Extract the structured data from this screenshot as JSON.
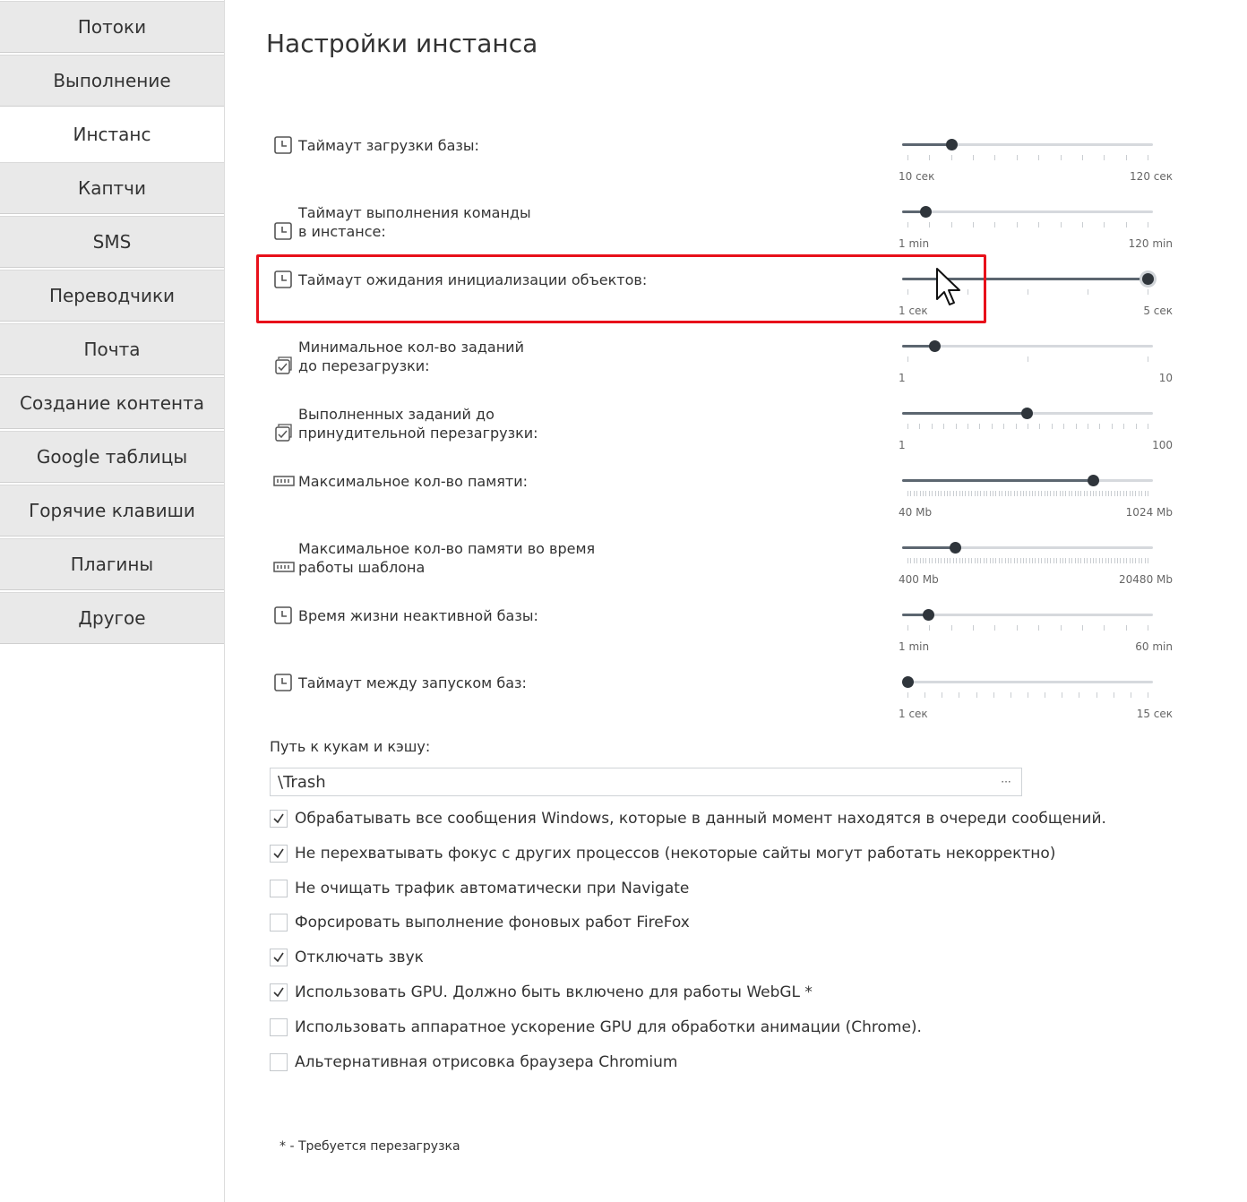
{
  "sidebar": {
    "items": [
      {
        "label": "Потоки",
        "active": false
      },
      {
        "label": "Выполнение",
        "active": false
      },
      {
        "label": "Инстанс",
        "active": true
      },
      {
        "label": "Каптчи",
        "active": false
      },
      {
        "label": "SMS",
        "active": false
      },
      {
        "label": "Переводчики",
        "active": false
      },
      {
        "label": "Почта",
        "active": false
      },
      {
        "label": "Создание контента",
        "active": false
      },
      {
        "label": "Google таблицы",
        "active": false
      },
      {
        "label": "Горячие клавиши",
        "active": false
      },
      {
        "label": "Плагины",
        "active": false
      },
      {
        "label": "Другое",
        "active": false
      }
    ]
  },
  "main": {
    "title": "Настройки инстанса",
    "sliders": [
      {
        "label": "Таймаут загрузки базы:",
        "icon": "clock-icon",
        "min_label": "10 сек",
        "max_label": "120 сек",
        "min": 10,
        "max": 120,
        "value": 30,
        "ticks": 12
      },
      {
        "label": "Таймаут выполнения команды\nв инстансе:",
        "icon": "clock-icon",
        "min_label": "1 min",
        "max_label": "120 min",
        "min": 1,
        "max": 120,
        "value": 10,
        "ticks": 12
      },
      {
        "label": "Таймаут ожидания инициализации объектов:",
        "icon": "clock-icon",
        "min_label": "1 сек",
        "max_label": "5 сек",
        "min": 1,
        "max": 5,
        "value": 5,
        "ticks": 5,
        "hover": true
      },
      {
        "label": "Минимальное кол-во заданий\nдо перезагрузки:",
        "icon": "task-icon",
        "min_label": "1",
        "max_label": "10",
        "min": 1,
        "max": 10,
        "value": 2,
        "ticks": 3
      },
      {
        "label": "Выполненных заданий до\nпринудительной перезагрузки:",
        "icon": "task-icon",
        "min_label": "1",
        "max_label": "100",
        "min": 1,
        "max": 100,
        "value": 50,
        "ticks": 21
      },
      {
        "label": "Максимальное кол-во памяти:",
        "icon": "memory-icon",
        "min_label": "40 Mb",
        "max_label": "1024 Mb",
        "min": 40,
        "max": 1024,
        "value": 800,
        "ticks": 80
      },
      {
        "label": "Максимальное кол-во памяти во время\nработы шаблона",
        "icon": "memory-icon",
        "min_label": "400 Mb",
        "max_label": "20480 Mb",
        "min": 400,
        "max": 20480,
        "value": 4400,
        "ticks": 80
      },
      {
        "label": "Время жизни неактивной базы:",
        "icon": "clock-icon",
        "min_label": "1 min",
        "max_label": "60 min",
        "min": 1,
        "max": 60,
        "value": 6,
        "ticks": 12
      },
      {
        "label": "Таймаут между запуском баз:",
        "icon": "clock-icon",
        "min_label": "1 сек",
        "max_label": "15 сек",
        "min": 1,
        "max": 15,
        "value": 1,
        "ticks": 15
      }
    ],
    "path": {
      "label": "Путь к кукам и кэшу:",
      "value": "\\Trash",
      "browse_label": "···"
    },
    "checkboxes": [
      {
        "label": "Обрабатывать все сообщения Windows, которые в данный момент находятся в очереди сообщений.",
        "checked": true
      },
      {
        "label": "Не перехватывать фокус с других процессов (некоторые сайты могут работать некорректно)",
        "checked": true
      },
      {
        "label": "Не очищать трафик автоматически при Navigate",
        "checked": false
      },
      {
        "label": "Форсировать выполнение фоновых работ FireFox",
        "checked": false
      },
      {
        "label": "Отключать звук",
        "checked": true
      },
      {
        "label": "Использовать GPU. Должно быть включено для работы WebGL *",
        "checked": true
      },
      {
        "label": "Использовать аппаратное ускорение GPU для обработки анимации (Chrome).",
        "checked": false
      },
      {
        "label": "Альтернативная отрисовка браузера Chromium",
        "checked": false
      }
    ],
    "footnote": "* - Требуется перезагрузка"
  },
  "colors": {
    "accent_highlight": "#e8101a",
    "slider_thumb": "#2f353b",
    "slider_track": "#d6d9dd",
    "sidebar_bg": "#e9e9e9"
  }
}
